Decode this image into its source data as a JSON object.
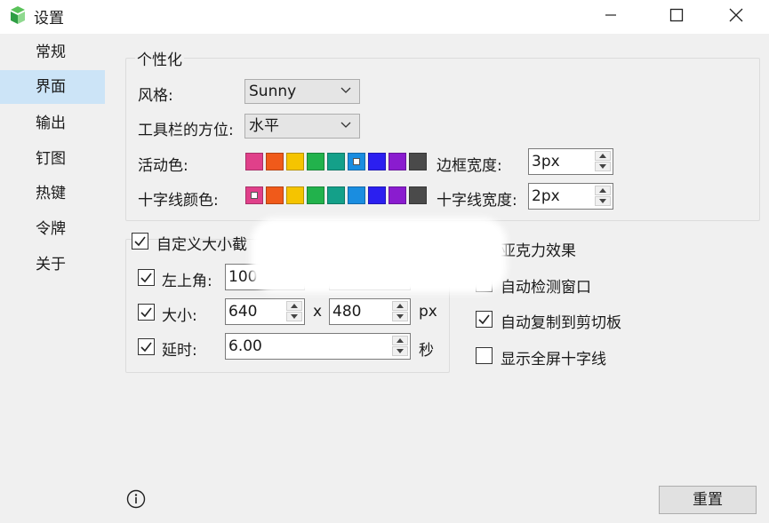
{
  "window": {
    "title": "设置",
    "app_icon": "snipaste-logo-icon"
  },
  "sidebar": {
    "items": [
      {
        "label": "常规"
      },
      {
        "label": "界面",
        "active": true
      },
      {
        "label": "输出"
      },
      {
        "label": "钉图"
      },
      {
        "label": "热键"
      },
      {
        "label": "令牌"
      },
      {
        "label": "关于"
      }
    ]
  },
  "personalize": {
    "title": "个性化",
    "style_label": "风格:",
    "style_value": "Sunny",
    "toolbar_pos_label": "工具栏的方位:",
    "toolbar_pos_value": "水平",
    "active_color_label": "活动色:",
    "crosshair_color_label": "十字线颜色:",
    "border_width_label": "边框宽度:",
    "border_width_value": "3px",
    "crosshair_width_label": "十字线宽度:",
    "crosshair_width_value": "2px",
    "palette": [
      "#e0408a",
      "#f05a1a",
      "#f5c400",
      "#22b24c",
      "#14a089",
      "#1a8de0",
      "#2b1ff0",
      "#8a1ccf",
      "#4a4a4a"
    ],
    "active_color_selected_index": 5,
    "crosshair_color_selected_index": 0
  },
  "custom_size": {
    "checkbox_label": "自定义大小截",
    "checked": true,
    "top_left": {
      "label": "左上角:",
      "x": "100",
      "checked": true
    },
    "size": {
      "label": "大小:",
      "w": "640",
      "sep": "x",
      "h": "480",
      "unit": "px",
      "checked": true
    },
    "delay": {
      "label": "延时:",
      "value": "6.00",
      "unit": "秒",
      "checked": true
    }
  },
  "options": [
    {
      "label": "亚克力效果",
      "checked": true
    },
    {
      "label": "自动检测窗口",
      "checked": false
    },
    {
      "label": "自动复制到剪切板",
      "checked": true
    },
    {
      "label": "显示全屏十字线",
      "checked": false
    }
  ],
  "footer": {
    "reset_label": "重置",
    "info_icon": "info-icon"
  }
}
